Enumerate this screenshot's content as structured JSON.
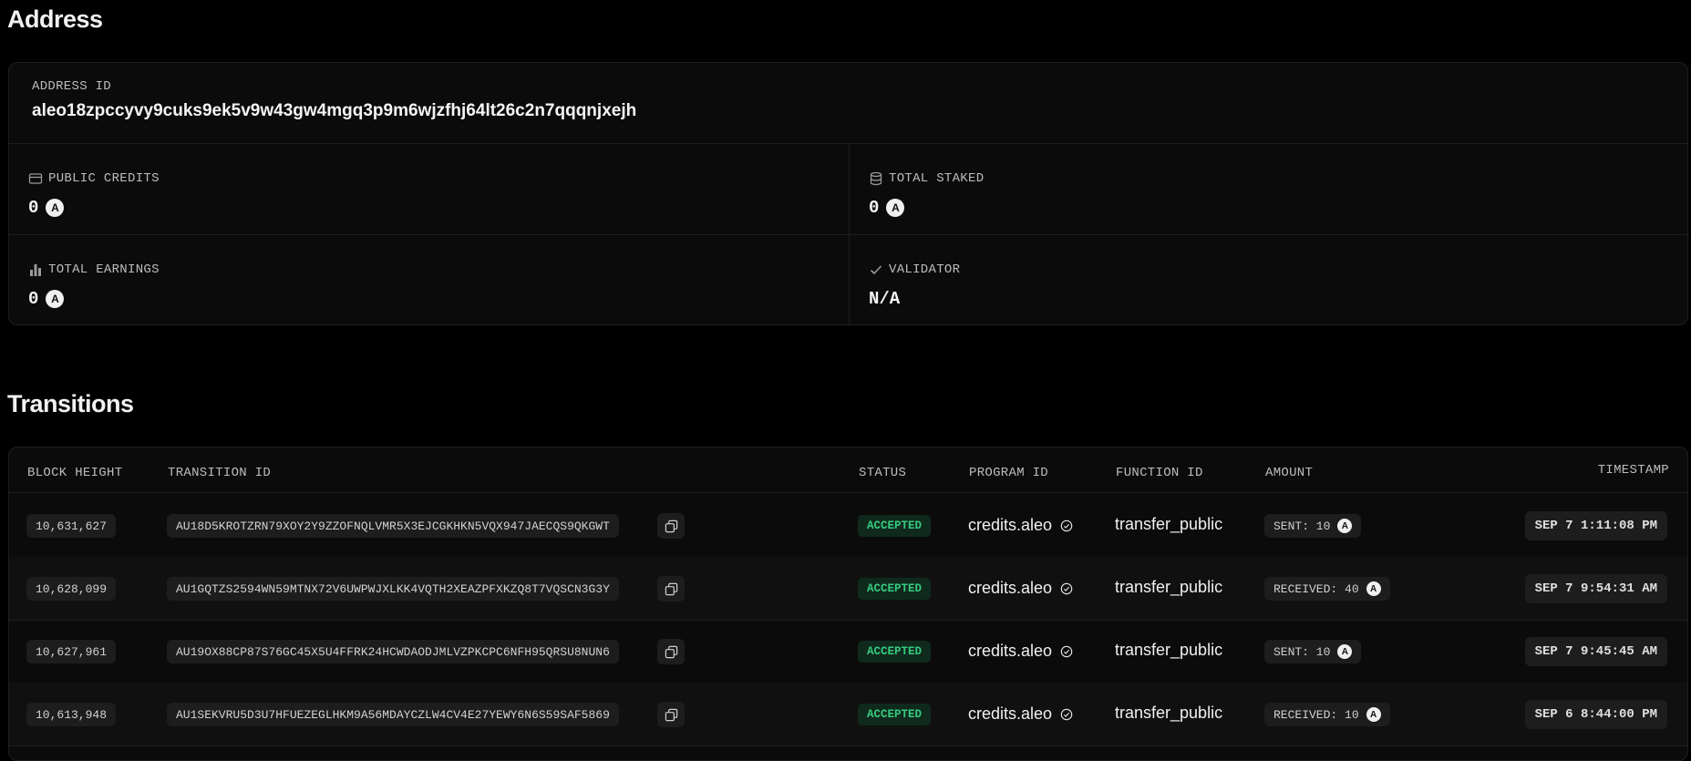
{
  "address_section": {
    "title": "Address",
    "address_id_label": "ADDRESS ID",
    "address_id": "aleo18zpccyvy9cuks9ek5v9w43gw4mgq3p9m6wjzfhj64lt26c2n7qqqnjxejh",
    "public_credits": {
      "label": "PUBLIC CREDITS",
      "value": "0",
      "icon": "wallet-icon"
    },
    "total_staked": {
      "label": "TOTAL STAKED",
      "value": "0",
      "icon": "database-icon"
    },
    "total_earnings": {
      "label": "TOTAL EARNINGS",
      "value": "0",
      "icon": "bar-chart-icon"
    },
    "validator": {
      "label": "VALIDATOR",
      "value": "N/A",
      "icon": "check-icon"
    },
    "token_badge": "A"
  },
  "transitions_section": {
    "title": "Transitions",
    "columns": {
      "block_height": "BLOCK HEIGHT",
      "transition_id": "TRANSITION ID",
      "status": "STATUS",
      "program_id": "PROGRAM ID",
      "function_id": "FUNCTION ID",
      "amount": "AMOUNT",
      "timestamp": "TIMESTAMP"
    },
    "rows": [
      {
        "block_height": "10,631,627",
        "transition_id": "AU18D5KROTZRN79XOY2Y9ZZOFNQLVMR5X3EJCGKHKN5VQX947JAECQS9QKGWT",
        "status": "ACCEPTED",
        "program_id": "credits.aleo",
        "function_id": "transfer_public",
        "amount": "SENT: 10",
        "timestamp": "SEP 7 1:11:08 PM"
      },
      {
        "block_height": "10,628,099",
        "transition_id": "AU1GQTZS2594WN59MTNX72V6UWPWJXLKK4VQTH2XEAZPFXKZQ8T7VQSCN3G3Y",
        "status": "ACCEPTED",
        "program_id": "credits.aleo",
        "function_id": "transfer_public",
        "amount": "RECEIVED: 40",
        "timestamp": "SEP 7 9:54:31 AM"
      },
      {
        "block_height": "10,627,961",
        "transition_id": "AU19OX88CP87S76GC45X5U4FFRK24HCWDAODJMLVZPKCPC6NFH95QRSU8NUN6",
        "status": "ACCEPTED",
        "program_id": "credits.aleo",
        "function_id": "transfer_public",
        "amount": "SENT: 10",
        "timestamp": "SEP 7 9:45:45 AM"
      },
      {
        "block_height": "10,613,948",
        "transition_id": "AU1SEKVRU5D3U7HFUEZEGLHKM9A56MDAYCZLW4CV4E27YEWY6N6S59SAF5869",
        "status": "ACCEPTED",
        "program_id": "credits.aleo",
        "function_id": "transfer_public",
        "amount": "RECEIVED: 10",
        "timestamp": "SEP 6 8:44:00 PM"
      }
    ]
  },
  "colors": {
    "background": "#000000",
    "card": "#0b0b0b",
    "accepted_text": "#36c97e",
    "accepted_bg": "#0f2a1d"
  }
}
